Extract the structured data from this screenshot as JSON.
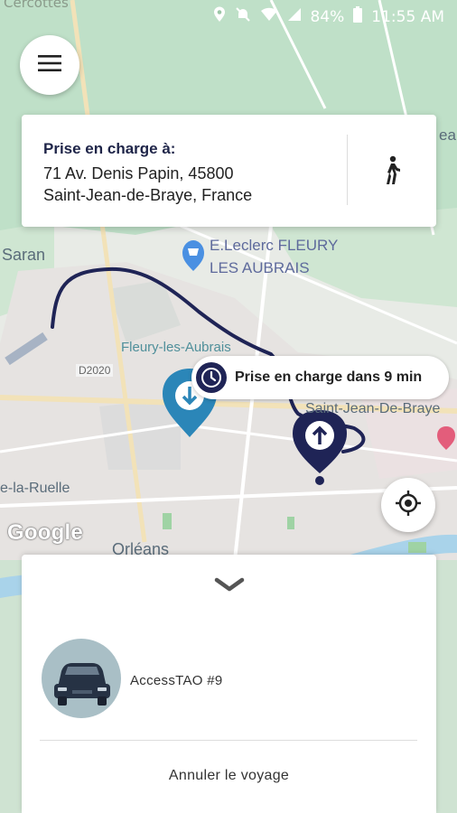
{
  "statusbar": {
    "battery": "84%",
    "time": "11:55 AM",
    "partial_label": "Cercottes"
  },
  "map": {
    "labels": {
      "saran": "Saran",
      "leclerc_line1": "E.Leclerc FLEURY",
      "leclerc_line2": "LES AUBRAIS",
      "fleury": "Fleury-les-Aubrais",
      "road": "D2020",
      "saint_jean": "Saint-Jean-De-Braye",
      "la_ruelle": "e-la-Ruelle",
      "orleans": "Orléans",
      "partial_right": "ea"
    },
    "google_logo": "Google",
    "eta": "Prise en charge dans 9 min",
    "route_color": "#1f2456",
    "pin_pickup_color": "#1f2456",
    "pin_dropoff_color": "#2b86b8"
  },
  "pickup": {
    "title": "Prise en charge à:",
    "address_line1": "71 Av. Denis Papin, 45800",
    "address_line2": "Saint-Jean-de-Braye, France"
  },
  "sheet": {
    "vehicle_name": "AccessTAO #9",
    "cancel_label": "Annuler le voyage"
  },
  "icons": [
    "menu-icon",
    "walk-icon",
    "clock-icon",
    "locate-icon",
    "chevron-down-icon",
    "car-icon",
    "location-icon",
    "mute-icon",
    "wifi-icon",
    "signal-icon",
    "battery-icon",
    "shopping-cart-icon",
    "hotel-icon"
  ]
}
